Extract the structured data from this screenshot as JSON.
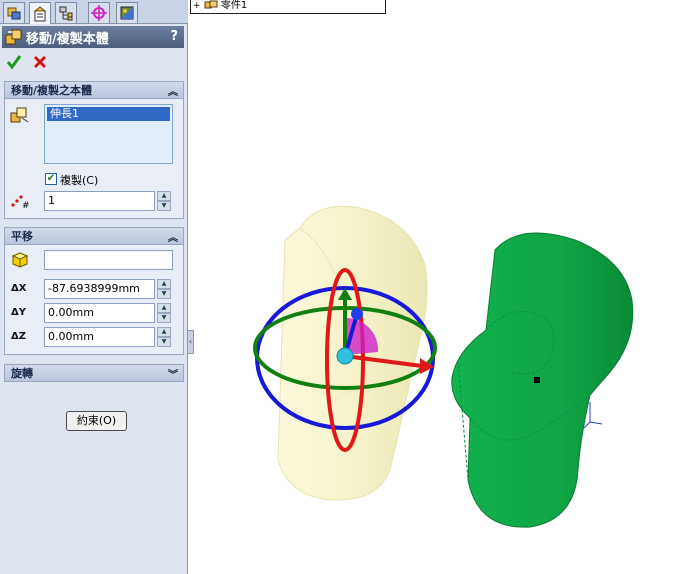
{
  "tabs": [
    {
      "icon": "feature-manager-icon",
      "active": false
    },
    {
      "icon": "property-manager-icon",
      "active": true
    },
    {
      "icon": "configuration-manager-icon",
      "active": false
    },
    {
      "icon": "dimxpert-icon",
      "active": false
    },
    {
      "icon": "display-manager-icon",
      "active": false
    }
  ],
  "panel": {
    "title": "移動/複製本體",
    "help": "?",
    "section_move_copy": "移動/複製之本體",
    "selected_body": "伸長1",
    "copy_label": "複製(C)",
    "copy_checked": true,
    "copy_count": "1",
    "section_translate": "平移",
    "translate_reference": "",
    "dx_label": "ΔX",
    "dx_value": "-87.6938999mm",
    "dy_label": "ΔY",
    "dy_value": "0.00mm",
    "dz_label": "ΔZ",
    "dz_value": "0.00mm",
    "section_rotate": "旋轉",
    "constraint_button": "約束(O)"
  },
  "tree": {
    "item": "零件1"
  },
  "colors": {
    "ghost_body": "#f4f2c4",
    "copied_body": "#10aa48",
    "triad_red": "#e01818",
    "triad_blue": "#1818d8",
    "triad_green": "#108010",
    "accent_magenta": "#d020c8"
  }
}
